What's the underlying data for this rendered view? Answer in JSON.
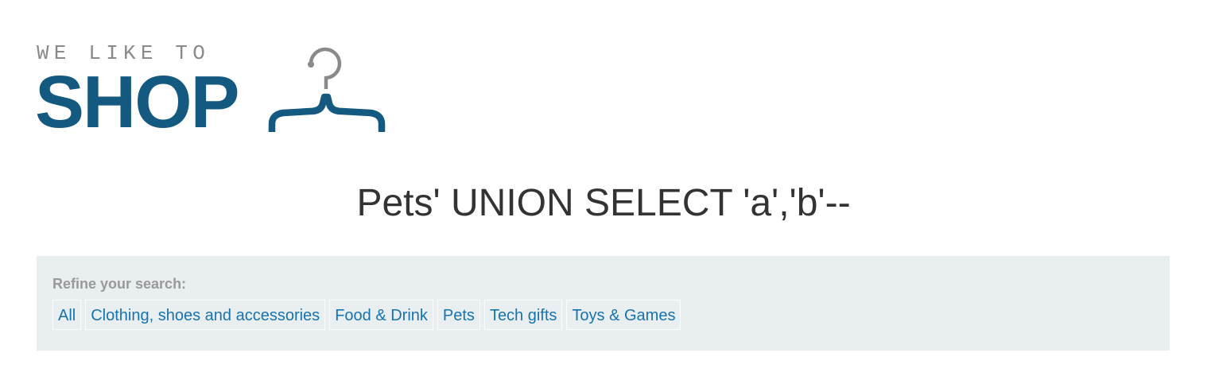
{
  "logo": {
    "tagline": "WE LIKE TO",
    "wordmark": "SHOP"
  },
  "page_title": "Pets' UNION SELECT 'a','b'--",
  "filters": {
    "heading": "Refine your search:",
    "items": [
      {
        "label": "All"
      },
      {
        "label": "Clothing, shoes and accessories"
      },
      {
        "label": "Food & Drink"
      },
      {
        "label": "Pets"
      },
      {
        "label": "Tech gifts"
      },
      {
        "label": "Toys & Games"
      }
    ]
  },
  "colors": {
    "brand_blue": "#145a80",
    "link_blue": "#1773b0",
    "panel_bg": "#e9eef1",
    "muted_gray": "#8a8a8a",
    "title_text": "#333333"
  }
}
